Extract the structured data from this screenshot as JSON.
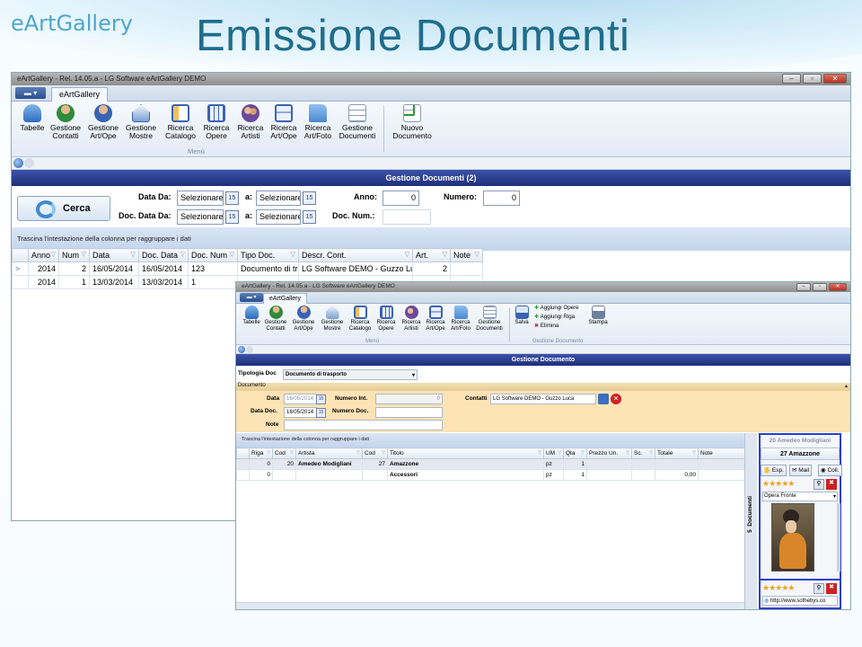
{
  "slide": {
    "logo": "eArtGallery",
    "title": "Emissione Documenti"
  },
  "win1": {
    "title": "eArtGallery - Rel. 14.05.a - LG Software eArtGallery DEMO",
    "tab": "eArtGallery",
    "ribbon": [
      {
        "l1": "Tabelle",
        "l2": ""
      },
      {
        "l1": "Gestione",
        "l2": "Contatti"
      },
      {
        "l1": "Gestione",
        "l2": "Art/Ope"
      },
      {
        "l1": "Gestione",
        "l2": "Mostre"
      },
      {
        "l1": "Ricerca",
        "l2": "Catalogo"
      },
      {
        "l1": "Ricerca",
        "l2": "Opere"
      },
      {
        "l1": "Ricerca",
        "l2": "Artisti"
      },
      {
        "l1": "Ricerca",
        "l2": "Art/Ope"
      },
      {
        "l1": "Ricerca",
        "l2": "Art/Foto"
      },
      {
        "l1": "Gestione",
        "l2": "Documenti"
      }
    ],
    "ribbon_group": "Menù",
    "new_doc": {
      "l1": "Nuovo",
      "l2": "Documento"
    },
    "header": "Gestione Documenti (2)",
    "cerca": "Cerca",
    "form": {
      "data_da": "Data Da:",
      "a1": "a:",
      "doc_data_da": "Doc. Data Da:",
      "a2": "a:",
      "placeholder": "Selezionare",
      "anno": "Anno:",
      "anno_val": "0",
      "numero": "Numero:",
      "numero_val": "0",
      "doc_num": "Doc. Num.:"
    },
    "group_hint": "Trascina l'intestazione della colonna per raggruppare i dati",
    "columns": [
      "Anno",
      "Num",
      "Data",
      "Doc. Data",
      "Doc. Num",
      "Tipo Doc.",
      "Descr. Cont.",
      "Art.",
      "Note"
    ],
    "rows": [
      {
        "anno": "2014",
        "num": "2",
        "data": "16/05/2014",
        "docdata": "16/05/2014",
        "docnum": "123",
        "tipo": "Documento di trasporto",
        "descr": "LG Software DEMO - Guzzo Luca",
        "art": "2",
        "note": ""
      },
      {
        "anno": "2014",
        "num": "1",
        "data": "13/03/2014",
        "docdata": "13/03/2014",
        "docnum": "1",
        "tipo": "",
        "descr": "",
        "art": "",
        "note": ""
      }
    ]
  },
  "win2": {
    "title": "eArtGallery - Rel. 14.05.a - LG Software eArtGallery DEMO",
    "tab": "eArtGallery",
    "ribbon_group": "Menù",
    "salva": "Salva",
    "agg_opere": "Aggiungi Opere",
    "agg_riga": "Aggiungi Riga",
    "elimina": "Elimina",
    "stampa": "Stampa",
    "gestione_doc_group": "Gestione Documento",
    "header": "Gestione Documento",
    "tipologia_label": "Tipologia Doc",
    "tipologia_val": "Documento di trasporto",
    "section": "Documento",
    "data": "Data",
    "data_val": "16/05/2014",
    "numero_int": "Numero Int.",
    "numero_int_val": "0",
    "contatti": "Contatti",
    "contatti_val": "LG Software DEMO - Guzzo Luca",
    "data_doc": "Data Doc.",
    "data_doc_val": "16/05/2014",
    "numero_doc": "Numero Doc.",
    "note": "Note",
    "group_hint": "Trascina l'intestazione della colonna per raggruppare i dati",
    "columns": [
      "Riga",
      "Cod",
      "Artista",
      "Cod",
      "Titolo",
      "UM",
      "Qta",
      "Prezzo Un.",
      "Sc.",
      "Totale",
      "Note"
    ],
    "rows": [
      {
        "riga": "0",
        "cod": "20",
        "artista": "Amedeo Modigliani",
        "cod2": "27",
        "titolo": "Amazzone",
        "um": "pz",
        "qta": "1",
        "prezzo": "",
        "sc": "",
        "totale": "",
        "note": ""
      },
      {
        "riga": "0",
        "cod": "",
        "artista": "",
        "cod2": "",
        "titolo": "Accessori",
        "um": "pz",
        "qta": "1",
        "prezzo": "",
        "sc": "",
        "totale": "0,00",
        "note": ""
      }
    ],
    "side_tab": "Documenti",
    "side_num": "5",
    "panel": {
      "artist": "20 Amedeo Modigliani",
      "work": "27 Amazzone",
      "esp": "Esp.",
      "mail": "Mail",
      "coll": "Coll.",
      "view": "Opera Fronte",
      "url": "http://www.sothebys.co"
    }
  }
}
